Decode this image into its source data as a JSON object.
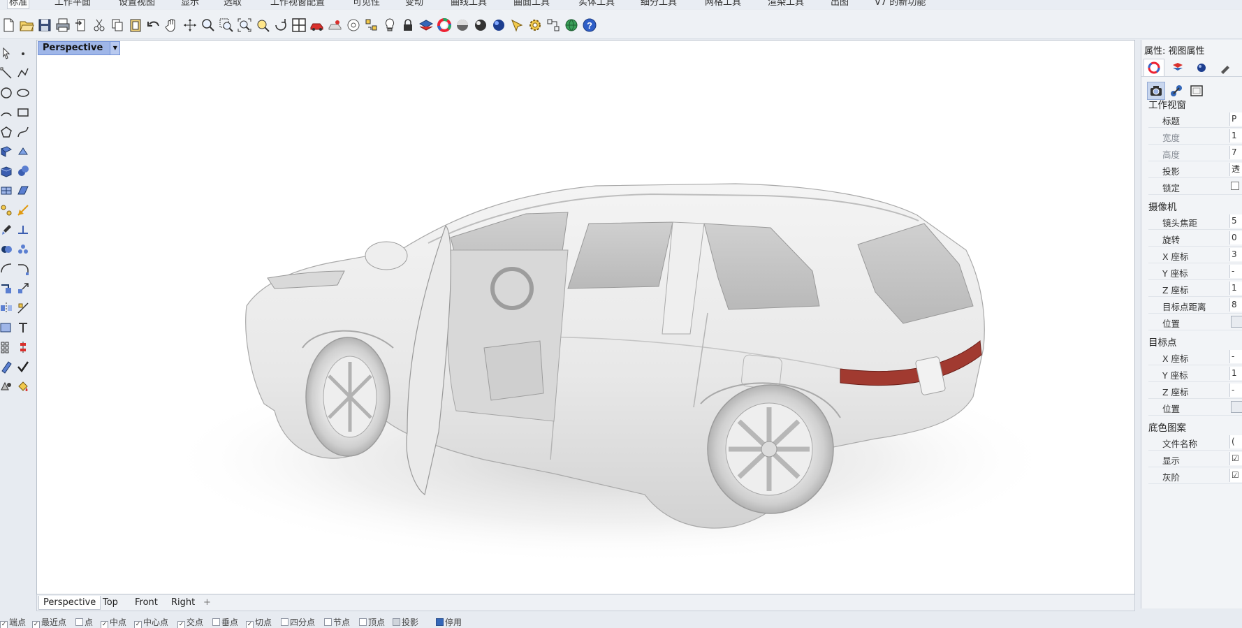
{
  "menu_tabs": [
    "标准",
    "工作平面",
    "设置视图",
    "显示",
    "选取",
    "工作视窗配置",
    "可见性",
    "变动",
    "曲线工具",
    "曲面工具",
    "实体工具",
    "细分工具",
    "网格工具",
    "渲染工具",
    "出图",
    "V7 的新功能"
  ],
  "toolbar_icons": [
    "new-file-icon",
    "open-icon",
    "save-icon",
    "print-icon",
    "import-icon",
    "cut-icon",
    "copy-icon",
    "paste-icon",
    "undo-icon",
    "pan-icon",
    "rotate-view-icon",
    "zoom-icon",
    "zoom-window-icon",
    "zoom-extents-icon",
    "zoom-selected-icon",
    "rotate-icon",
    "four-viewports-icon",
    "car-view-icon",
    "shaded-icon",
    "rendered-icon",
    "select-points-icon",
    "light-icon",
    "lock-icon",
    "layer-icon",
    "color-wheel-icon",
    "sphere-icon",
    "material-icon",
    "render-sphere-icon",
    "snap-icon",
    "settings-gear-icon",
    "options-icon",
    "globe-icon",
    "help-icon"
  ],
  "viewport": {
    "title": "Perspective",
    "tabs": [
      "Perspective",
      "Top",
      "Front",
      "Right"
    ],
    "active_tab": "Perspective",
    "add_tab_glyph": "+"
  },
  "osnap": [
    {
      "label": "端点",
      "checked": true
    },
    {
      "label": "最近点",
      "checked": true
    },
    {
      "label": "点",
      "checked": false
    },
    {
      "label": "中点",
      "checked": true
    },
    {
      "label": "中心点",
      "checked": true
    },
    {
      "label": "交点",
      "checked": true
    },
    {
      "label": "垂点",
      "checked": false
    },
    {
      "label": "切点",
      "checked": true
    },
    {
      "label": "四分点",
      "checked": false
    },
    {
      "label": "节点",
      "checked": false
    },
    {
      "label": "顶点",
      "checked": false
    },
    {
      "label": "投影",
      "checked": false
    },
    {
      "label": "停用",
      "checked": true
    }
  ],
  "properties": {
    "title": "属性: 视图属性",
    "sections": [
      {
        "heading": "工作视窗",
        "rows": [
          {
            "label": "标题",
            "value": "P",
            "kind": "text",
            "disabled": false
          },
          {
            "label": "宽度",
            "value": "1",
            "kind": "text",
            "disabled": true
          },
          {
            "label": "高度",
            "value": "7",
            "kind": "text",
            "disabled": true
          },
          {
            "label": "投影",
            "value": "透",
            "kind": "text",
            "disabled": false
          },
          {
            "label": "锁定",
            "value": "",
            "kind": "checkbox",
            "disabled": false
          }
        ]
      },
      {
        "heading": "摄像机",
        "rows": [
          {
            "label": "镜头焦距",
            "value": "5",
            "kind": "text",
            "disabled": false
          },
          {
            "label": "旋转",
            "value": "0",
            "kind": "text",
            "disabled": false
          },
          {
            "label": "X 座标",
            "value": "3",
            "kind": "text",
            "disabled": false
          },
          {
            "label": "Y 座标",
            "value": "-",
            "kind": "text",
            "disabled": false
          },
          {
            "label": "Z 座标",
            "value": "1",
            "kind": "text",
            "disabled": false
          },
          {
            "label": "目标点距离",
            "value": "8",
            "kind": "text",
            "disabled": false
          },
          {
            "label": "位置",
            "value": "",
            "kind": "button",
            "disabled": false
          }
        ]
      },
      {
        "heading": "目标点",
        "rows": [
          {
            "label": "X 座标",
            "value": "-",
            "kind": "text",
            "disabled": false
          },
          {
            "label": "Y 座标",
            "value": "1",
            "kind": "text",
            "disabled": false
          },
          {
            "label": "Z 座标",
            "value": "-",
            "kind": "text",
            "disabled": false
          },
          {
            "label": "位置",
            "value": "",
            "kind": "button",
            "disabled": false
          }
        ]
      },
      {
        "heading": "底色图案",
        "rows": [
          {
            "label": "文件名称",
            "value": "(",
            "kind": "text",
            "disabled": false
          },
          {
            "label": "显示",
            "value": "☑",
            "kind": "text",
            "disabled": false
          },
          {
            "label": "灰阶",
            "value": "☑",
            "kind": "text",
            "disabled": false
          }
        ]
      }
    ]
  },
  "colors": {
    "viewport_title_bg": "#9fb6e8",
    "accent": "#3467b8",
    "background": "#e7ebf1"
  }
}
